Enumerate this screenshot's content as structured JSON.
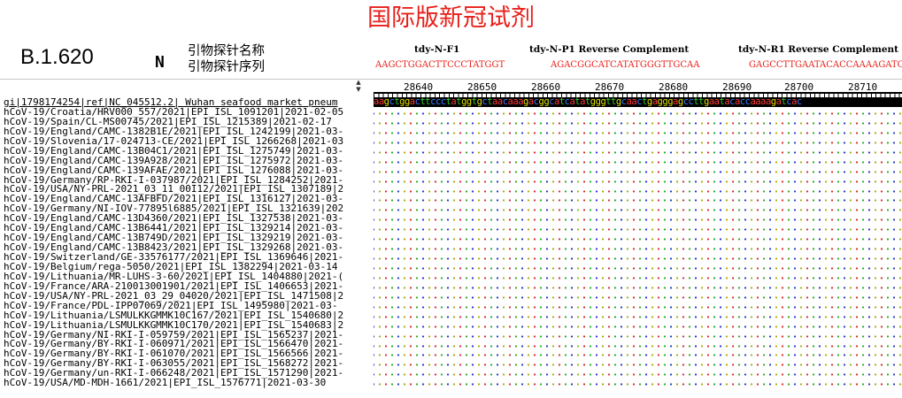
{
  "title": "国际版新冠试剂",
  "lineage": "B.1.620",
  "base_symbol": "N",
  "header_labels": {
    "probe_name": "引物探针名称",
    "probe_seq": "引物探针序列"
  },
  "primers": [
    {
      "name": "tdy-N-F1",
      "seq": "AAGCTGGACTTCCCTATGGT"
    },
    {
      "name": "tdy-N-P1 Reverse Complement",
      "seq": "AGACGGCATCATATGGGTTGCAA"
    },
    {
      "name": "tdy-N-R1 Reverse Complement",
      "seq": "GAGCCTTGAATACACCAAAAGATCAC"
    }
  ],
  "ruler_positions": [
    "28640",
    "28650",
    "28660",
    "28670",
    "28680",
    "28690",
    "28700",
    "28710"
  ],
  "reference_sequence": "aagctggacttccctatggtgctaacaaagacggcatcatatgggttgcaactgagggagccttgaatacaccaaaagatcac",
  "colors": {
    "title": "#e8201a",
    "primer_seq": "#e8201a",
    "A": "#ff3a3a",
    "C": "#3a7bff",
    "G": "#e0e000",
    "T": "#30d030"
  },
  "sequence_names": [
    "gi|1798174254|ref|NC_045512.2| Wuhan seafood market pneum",
    "hCoV-19/Croatia/HRV000_557/2021|EPI_ISL_1091201|2021-02-05",
    "hCoV-19/Spain/CL-MS00745/2021|EPI_ISL_1215389|2021-02-17",
    "hCoV-19/England/CAMC-1382B1E/2021|EPI_ISL_1242199|2021-03-",
    "hCoV-19/Slovenia/17-024713-CE/2021|EPI_ISL_1266268|2021-03",
    "hCoV-19/England/CAMC-13B04C1/2021|EPI_ISL_1275749|2021-03-",
    "hCoV-19/England/CAMC-139A928/2021|EPI_ISL_1275972|2021-03-",
    "hCoV-19/England/CAMC-139AFAE/2021|EPI_ISL_1276088|2021-03-",
    "hCoV-19/Germany/RP-RKI-I-037987/2021|EPI_ISL_1284252|2021-",
    "hCoV-19/USA/NY-PRL-2021_03_11_00I12/2021|EPI_ISL_1307189|2",
    "hCoV-19/England/CAMC-13AFBFD/2021|EPI_ISL_1316127|2021-03-",
    "hCoV-19/Germany/NI-IOV-77895l6885/2021|EPI_ISL_1321639|202",
    "hCoV-19/England/CAMC-13D4360/2021|EPI_ISL_1327538|2021-03-",
    "hCoV-19/England/CAMC-13B6441/2021|EPI_ISL_1329214|2021-03-",
    "hCoV-19/England/CAMC-13B749D/2021|EPI_ISL_1329219|2021-03-",
    "hCoV-19/England/CAMC-13B8423/2021|EPI_ISL_1329268|2021-03-",
    "hCoV-19/Switzerland/GE-33576177/2021|EPI_ISL_1369646|2021-",
    "hCoV-19/Belgium/rega-5050/2021|EPI_ISL_1382294|2021-03-14",
    "hCoV-19/Lithuania/MR-LUHS-3-60/2021|EPI_ISL_1404880|2021-(",
    "hCoV-19/France/ARA-210013001901/2021|EPI_ISL_1406653|2021-",
    "hCoV-19/USA/NY-PRL-2021_03_29_04020/2021|EPI_ISL_1471508|2",
    "hCoV-19/France/PDL-IPP07069/2021|EPI_ISL_1495980|2021-03-",
    "hCoV-19/Lithuania/LSMULKKGMMK10C167/2021|EPI_ISL_1540680|2",
    "hCoV-19/Lithuania/LSMULKKGMMK10C170/2021|EPI_ISL_1540683|2",
    "hCoV-19/Germany/NI-RKI-I-059759/2021|EPI_ISL_1565237|2021-",
    "hCoV-19/Germany/BY-RKI-I-060971/2021|EPI_ISL_1566470|2021-",
    "hCoV-19/Germany/BY-RKI-I-061070/2021|EPI_ISL_1566566|2021-",
    "hCoV-19/Germany/BY-RKI-I-063055/2021|EPI_ISL_1568272|2021-",
    "hCoV-19/Germany/un-RKI-I-066248/2021|EPI_ISL_1571290|2021-",
    "hCoV-19/USA/MD-MDH-1661/2021|EPI_ISL_1576771|2021-03-30"
  ]
}
